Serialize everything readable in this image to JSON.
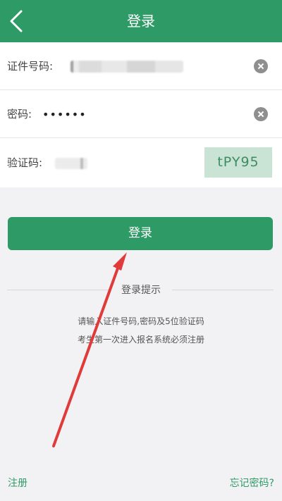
{
  "header": {
    "title": "登录",
    "back_icon": "chevron-left-icon"
  },
  "form": {
    "id_label": "证件号码:",
    "password_label": "密码:",
    "password_value": "••••••",
    "captcha_label": "验证码:",
    "captcha_text": "tPY95",
    "clear_icon": "clear-circle-icon"
  },
  "login_button": {
    "label": "登录"
  },
  "tips": {
    "title": "登录提示",
    "line1": "请输入证件号码,密码及5位验证码",
    "line2": "考生第一次进入报名系统必须注册"
  },
  "footer": {
    "register_label": "注册",
    "forgot_label": "忘记密码?"
  },
  "colors": {
    "brand_green": "#2e9b66",
    "annotation_red": "#e03a3a",
    "captcha_bg": "#c9e4d4"
  }
}
